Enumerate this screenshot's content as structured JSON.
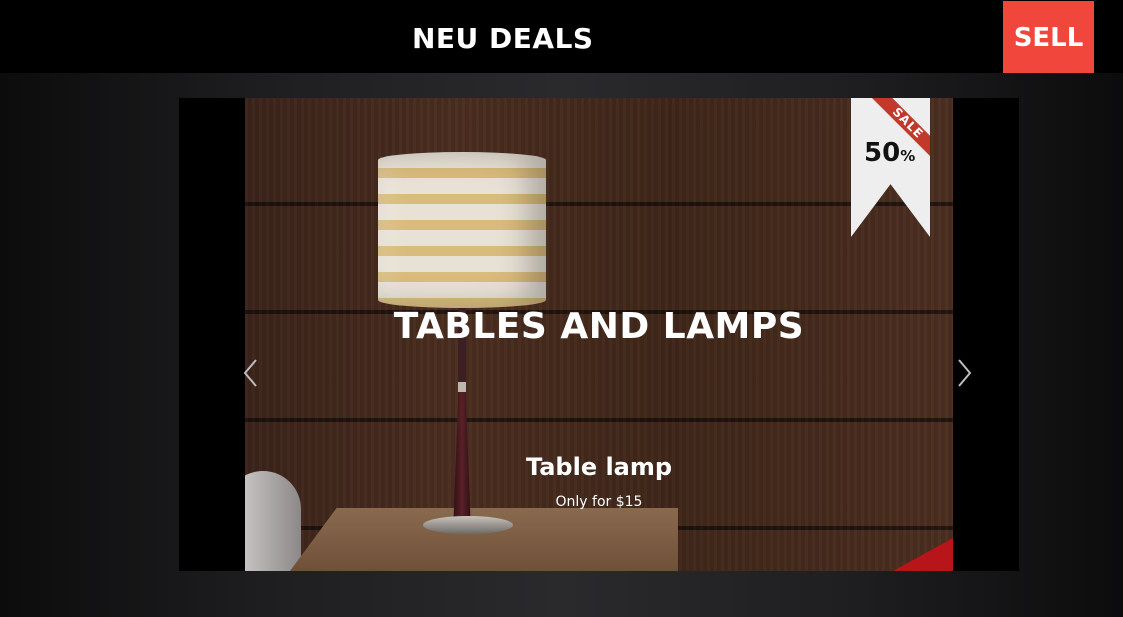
{
  "header": {
    "brand": "NEU DEALS",
    "sell_label": "SELL",
    "sell_color": "#f1463c"
  },
  "slider": {
    "title": "TABLES AND LAMPS",
    "product_name": "Table lamp",
    "price_text": "Only for $15",
    "prev_icon": "chevron-left-icon",
    "next_icon": "chevron-right-icon"
  },
  "badge": {
    "label": "SALE",
    "percent_value": "50",
    "percent_sign": "%",
    "ribbon_color": "#c0392b"
  }
}
